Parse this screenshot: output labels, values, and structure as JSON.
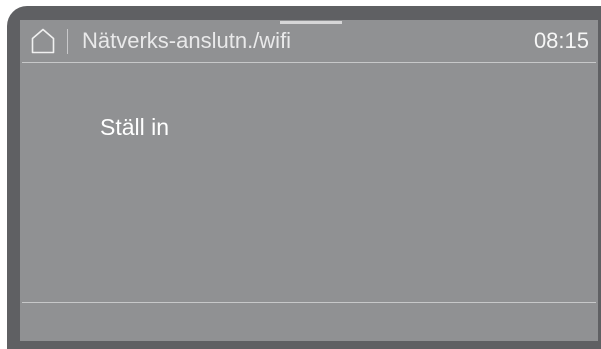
{
  "header": {
    "home_icon": "home-icon",
    "title": "Nätverks-anslutn./wifi",
    "time": "08:15"
  },
  "menu": {
    "items": [
      {
        "label": "Ställ in"
      }
    ]
  },
  "colors": {
    "bezel": "#5f6063",
    "screen_background": "#909193",
    "text": "#ffffff",
    "divider": "#c7c8c9"
  }
}
